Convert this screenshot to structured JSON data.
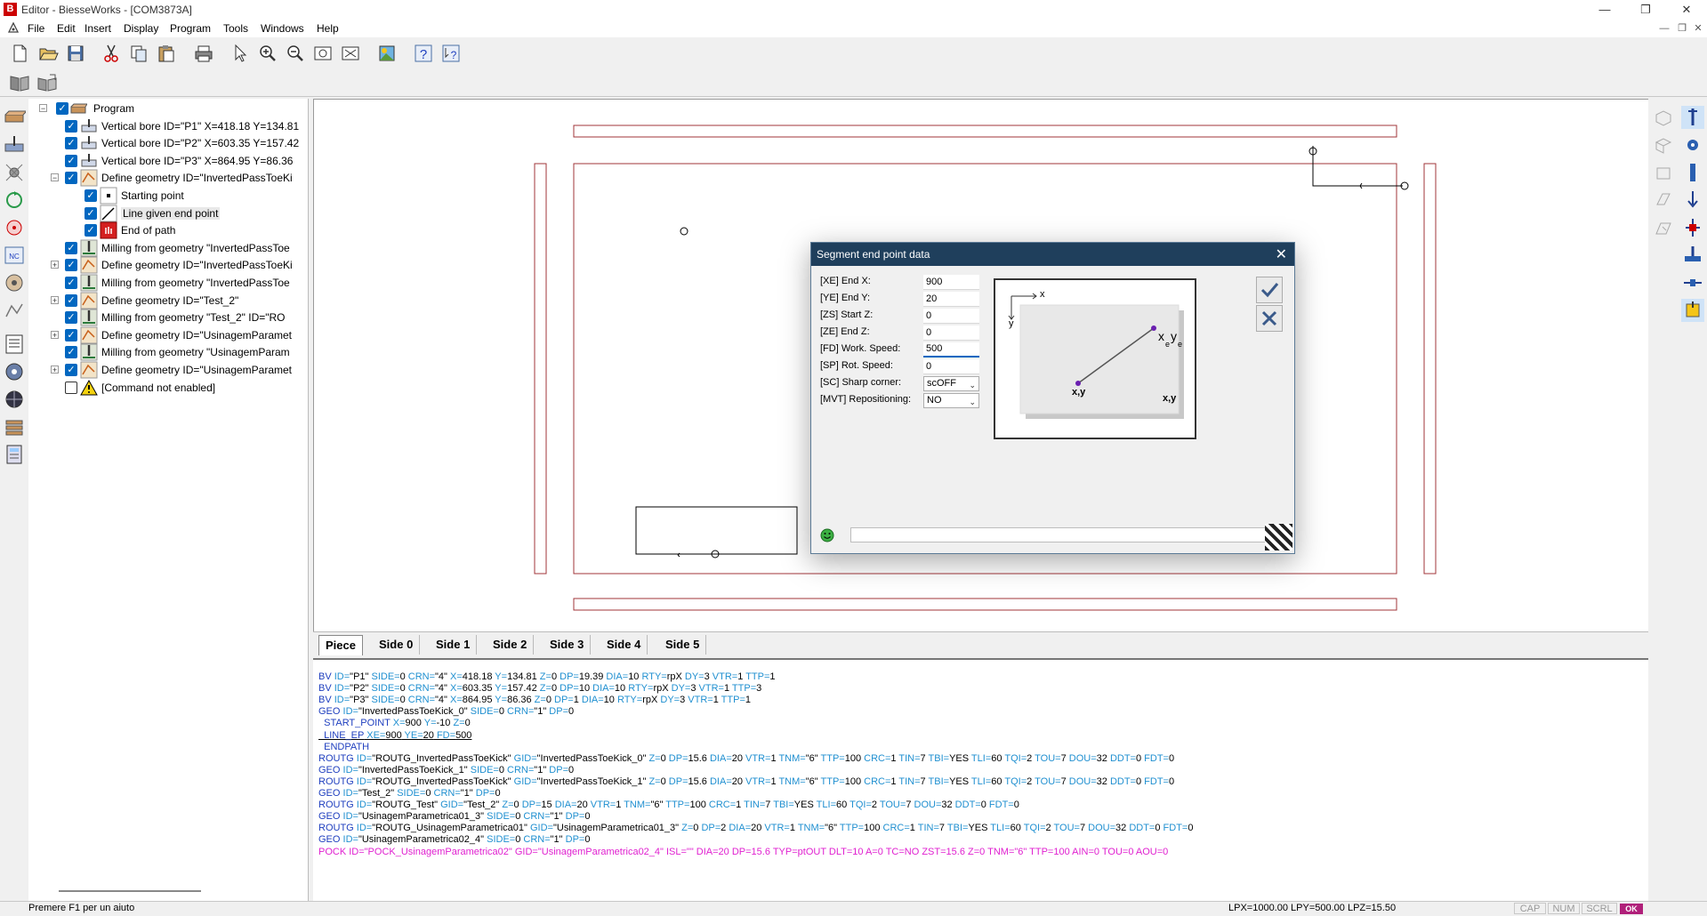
{
  "window": {
    "title": "Editor - BiesseWorks - [COM3873A]",
    "app_icon_letter": "B"
  },
  "menu": [
    "File",
    "Edit",
    "Insert",
    "Display",
    "Program",
    "Tools",
    "Windows",
    "Help"
  ],
  "tree": {
    "root": "Program",
    "items": [
      {
        "label": "Vertical bore ID=\"P1\" X=418.18 Y=134.81",
        "icon": "vertical-bore-icon"
      },
      {
        "label": "Vertical bore ID=\"P2\" X=603.35 Y=157.42",
        "icon": "vertical-bore-icon"
      },
      {
        "label": "Vertical bore ID=\"P3\" X=864.95 Y=86.36",
        "icon": "vertical-bore-icon"
      },
      {
        "label": "Define geometry ID=\"InvertedPassToeKi",
        "icon": "geometry-icon"
      },
      {
        "label": "Starting point",
        "icon": "starting-point-icon"
      },
      {
        "label": "Line given end point",
        "icon": "line-end-point-icon"
      },
      {
        "label": "End of path",
        "icon": "end-path-icon"
      },
      {
        "label": "Milling from geometry \"InvertedPassToe",
        "icon": "milling-icon"
      },
      {
        "label": "Define geometry ID=\"InvertedPassToeKi",
        "icon": "geometry-icon"
      },
      {
        "label": "Milling from geometry \"InvertedPassToe",
        "icon": "milling-icon"
      },
      {
        "label": "Define geometry ID=\"Test_2\"",
        "icon": "geometry-icon"
      },
      {
        "label": "Milling from geometry \"Test_2\" ID=\"RO",
        "icon": "milling-icon"
      },
      {
        "label": "Define geometry ID=\"UsinagemParamet",
        "icon": "geometry-icon"
      },
      {
        "label": "Milling from geometry \"UsinagemParam",
        "icon": "milling-icon"
      },
      {
        "label": "Define geometry ID=\"UsinagemParamet",
        "icon": "geometry-icon"
      },
      {
        "label": "[Command not enabled]",
        "icon": "warning-icon"
      }
    ]
  },
  "tabs": [
    "Piece",
    "Side 0",
    "Side 1",
    "Side 2",
    "Side 3",
    "Side 4",
    "Side 5"
  ],
  "active_tab": "Piece",
  "dialog": {
    "title": "Segment end point data",
    "fields": [
      {
        "label": "[XE] End X:",
        "value": "900"
      },
      {
        "label": "[YE] End Y:",
        "value": "20"
      },
      {
        "label": "[ZS] Start Z:",
        "value": "0"
      },
      {
        "label": "[ZE] End Z:",
        "value": "0"
      },
      {
        "label": "[FD] Work. Speed:",
        "value": "500"
      },
      {
        "label": "[SP] Rot. Speed:",
        "value": "0"
      }
    ],
    "selects": [
      {
        "label": "[SC] Sharp corner:",
        "value": "scOFF"
      },
      {
        "label": "[MVT] Repositioning:",
        "value": "NO"
      }
    ],
    "preview": {
      "axis_x": "x",
      "axis_y": "y",
      "end_label_x": "x",
      "end_label_y": "y",
      "end_sub": "e",
      "start_label": "x,y",
      "corner_label": "x,y"
    }
  },
  "code": [
    [
      [
        "BV",
        "kw"
      ],
      [
        " ID=",
        "at"
      ],
      [
        "\"P1\"",
        "v"
      ],
      [
        " SIDE=",
        "at"
      ],
      [
        "0",
        "v"
      ],
      [
        " CRN=",
        "at"
      ],
      [
        "\"4\"",
        "v"
      ],
      [
        " X=",
        "at"
      ],
      [
        "418.18",
        "v"
      ],
      [
        " Y=",
        "at"
      ],
      [
        "134.81",
        "v"
      ],
      [
        " Z=",
        "at"
      ],
      [
        "0",
        "v"
      ],
      [
        " DP=",
        "at"
      ],
      [
        "19.39",
        "v"
      ],
      [
        " DIA=",
        "at"
      ],
      [
        "10",
        "v"
      ],
      [
        " RTY=",
        "at"
      ],
      [
        "rpX",
        "v"
      ],
      [
        " DY=",
        "at"
      ],
      [
        "3",
        "v"
      ],
      [
        " VTR=",
        "at"
      ],
      [
        "1",
        "v"
      ],
      [
        " TTP=",
        "at"
      ],
      [
        "1",
        "v"
      ]
    ],
    [
      [
        "BV",
        "kw"
      ],
      [
        " ID=",
        "at"
      ],
      [
        "\"P2\"",
        "v"
      ],
      [
        " SIDE=",
        "at"
      ],
      [
        "0",
        "v"
      ],
      [
        " CRN=",
        "at"
      ],
      [
        "\"4\"",
        "v"
      ],
      [
        " X=",
        "at"
      ],
      [
        "603.35",
        "v"
      ],
      [
        " Y=",
        "at"
      ],
      [
        "157.42",
        "v"
      ],
      [
        " Z=",
        "at"
      ],
      [
        "0",
        "v"
      ],
      [
        " DP=",
        "at"
      ],
      [
        "10",
        "v"
      ],
      [
        " DIA=",
        "at"
      ],
      [
        "10",
        "v"
      ],
      [
        " RTY=",
        "at"
      ],
      [
        "rpX",
        "v"
      ],
      [
        " DY=",
        "at"
      ],
      [
        "3",
        "v"
      ],
      [
        " VTR=",
        "at"
      ],
      [
        "1",
        "v"
      ],
      [
        " TTP=",
        "at"
      ],
      [
        "3",
        "v"
      ]
    ],
    [
      [
        "BV",
        "kw"
      ],
      [
        " ID=",
        "at"
      ],
      [
        "\"P3\"",
        "v"
      ],
      [
        " SIDE=",
        "at"
      ],
      [
        "0",
        "v"
      ],
      [
        " CRN=",
        "at"
      ],
      [
        "\"4\"",
        "v"
      ],
      [
        " X=",
        "at"
      ],
      [
        "864.95",
        "v"
      ],
      [
        " Y=",
        "at"
      ],
      [
        "86.36",
        "v"
      ],
      [
        " Z=",
        "at"
      ],
      [
        "0",
        "v"
      ],
      [
        " DP=",
        "at"
      ],
      [
        "1",
        "v"
      ],
      [
        " DIA=",
        "at"
      ],
      [
        "10",
        "v"
      ],
      [
        " RTY=",
        "at"
      ],
      [
        "rpX",
        "v"
      ],
      [
        " DY=",
        "at"
      ],
      [
        "3",
        "v"
      ],
      [
        " VTR=",
        "at"
      ],
      [
        "1",
        "v"
      ],
      [
        " TTP=",
        "at"
      ],
      [
        "1",
        "v"
      ]
    ],
    [
      [
        "GEO",
        "kw"
      ],
      [
        " ID=",
        "at"
      ],
      [
        "\"InvertedPassToeKick_0\"",
        "v"
      ],
      [
        " SIDE=",
        "at"
      ],
      [
        "0",
        "v"
      ],
      [
        " CRN=",
        "at"
      ],
      [
        "\"1\"",
        "v"
      ],
      [
        " DP=",
        "at"
      ],
      [
        "0",
        "v"
      ]
    ],
    [
      [
        "  START_POINT",
        "kw"
      ],
      [
        " X=",
        "at"
      ],
      [
        "900",
        "v"
      ],
      [
        " Y=",
        "at"
      ],
      [
        "-10",
        "v"
      ],
      [
        " Z=",
        "at"
      ],
      [
        "0",
        "v"
      ]
    ],
    [
      [
        "  LINE_EP",
        "kw"
      ],
      [
        " XE=",
        "at"
      ],
      [
        "900",
        "v"
      ],
      [
        " YE=",
        "at"
      ],
      [
        "20",
        "v"
      ],
      [
        " FD=",
        "at"
      ],
      [
        "500",
        "v"
      ]
    ],
    [
      [
        "  ENDPATH",
        "kw"
      ]
    ],
    [
      [
        "ROUTG",
        "kw"
      ],
      [
        " ID=",
        "at"
      ],
      [
        "\"ROUTG_InvertedPassToeKick\"",
        "v"
      ],
      [
        " GID=",
        "at"
      ],
      [
        "\"InvertedPassToeKick_0\"",
        "v"
      ],
      [
        " Z=",
        "at"
      ],
      [
        "0",
        "v"
      ],
      [
        " DP=",
        "at"
      ],
      [
        "15.6",
        "v"
      ],
      [
        " DIA=",
        "at"
      ],
      [
        "20",
        "v"
      ],
      [
        " VTR=",
        "at"
      ],
      [
        "1",
        "v"
      ],
      [
        " TNM=",
        "at"
      ],
      [
        "\"6\"",
        "v"
      ],
      [
        " TTP=",
        "at"
      ],
      [
        "100",
        "v"
      ],
      [
        " CRC=",
        "at"
      ],
      [
        "1",
        "v"
      ],
      [
        " TIN=",
        "at"
      ],
      [
        "7",
        "v"
      ],
      [
        " TBI=",
        "at"
      ],
      [
        "YES",
        "v"
      ],
      [
        " TLI=",
        "at"
      ],
      [
        "60",
        "v"
      ],
      [
        " TQI=",
        "at"
      ],
      [
        "2",
        "v"
      ],
      [
        " TOU=",
        "at"
      ],
      [
        "7",
        "v"
      ],
      [
        " DOU=",
        "at"
      ],
      [
        "32",
        "v"
      ],
      [
        " DDT=",
        "at"
      ],
      [
        "0",
        "v"
      ],
      [
        " FDT=",
        "at"
      ],
      [
        "0",
        "v"
      ]
    ],
    [
      [
        "GEO",
        "kw"
      ],
      [
        " ID=",
        "at"
      ],
      [
        "\"InvertedPassToeKick_1\"",
        "v"
      ],
      [
        " SIDE=",
        "at"
      ],
      [
        "0",
        "v"
      ],
      [
        " CRN=",
        "at"
      ],
      [
        "\"1\"",
        "v"
      ],
      [
        " DP=",
        "at"
      ],
      [
        "0",
        "v"
      ]
    ],
    [
      [
        "ROUTG",
        "kw"
      ],
      [
        " ID=",
        "at"
      ],
      [
        "\"ROUTG_InvertedPassToeKick\"",
        "v"
      ],
      [
        " GID=",
        "at"
      ],
      [
        "\"InvertedPassToeKick_1\"",
        "v"
      ],
      [
        " Z=",
        "at"
      ],
      [
        "0",
        "v"
      ],
      [
        " DP=",
        "at"
      ],
      [
        "15.6",
        "v"
      ],
      [
        " DIA=",
        "at"
      ],
      [
        "20",
        "v"
      ],
      [
        " VTR=",
        "at"
      ],
      [
        "1",
        "v"
      ],
      [
        " TNM=",
        "at"
      ],
      [
        "\"6\"",
        "v"
      ],
      [
        " TTP=",
        "at"
      ],
      [
        "100",
        "v"
      ],
      [
        " CRC=",
        "at"
      ],
      [
        "1",
        "v"
      ],
      [
        " TIN=",
        "at"
      ],
      [
        "7",
        "v"
      ],
      [
        " TBI=",
        "at"
      ],
      [
        "YES",
        "v"
      ],
      [
        " TLI=",
        "at"
      ],
      [
        "60",
        "v"
      ],
      [
        " TQI=",
        "at"
      ],
      [
        "2",
        "v"
      ],
      [
        " TOU=",
        "at"
      ],
      [
        "7",
        "v"
      ],
      [
        " DOU=",
        "at"
      ],
      [
        "32",
        "v"
      ],
      [
        " DDT=",
        "at"
      ],
      [
        "0",
        "v"
      ],
      [
        " FDT=",
        "at"
      ],
      [
        "0",
        "v"
      ]
    ],
    [
      [
        "GEO",
        "kw"
      ],
      [
        " ID=",
        "at"
      ],
      [
        "\"Test_2\"",
        "v"
      ],
      [
        " SIDE=",
        "at"
      ],
      [
        "0",
        "v"
      ],
      [
        " CRN=",
        "at"
      ],
      [
        "\"1\"",
        "v"
      ],
      [
        " DP=",
        "at"
      ],
      [
        "0",
        "v"
      ]
    ],
    [
      [
        "ROUTG",
        "kw"
      ],
      [
        " ID=",
        "at"
      ],
      [
        "\"ROUTG_Test\"",
        "v"
      ],
      [
        " GID=",
        "at"
      ],
      [
        "\"Test_2\"",
        "v"
      ],
      [
        " Z=",
        "at"
      ],
      [
        "0",
        "v"
      ],
      [
        " DP=",
        "at"
      ],
      [
        "15",
        "v"
      ],
      [
        " DIA=",
        "at"
      ],
      [
        "20",
        "v"
      ],
      [
        " VTR=",
        "at"
      ],
      [
        "1",
        "v"
      ],
      [
        " TNM=",
        "at"
      ],
      [
        "\"6\"",
        "v"
      ],
      [
        " TTP=",
        "at"
      ],
      [
        "100",
        "v"
      ],
      [
        " CRC=",
        "at"
      ],
      [
        "1",
        "v"
      ],
      [
        " TIN=",
        "at"
      ],
      [
        "7",
        "v"
      ],
      [
        " TBI=",
        "at"
      ],
      [
        "YES",
        "v"
      ],
      [
        " TLI=",
        "at"
      ],
      [
        "60",
        "v"
      ],
      [
        " TQI=",
        "at"
      ],
      [
        "2",
        "v"
      ],
      [
        " TOU=",
        "at"
      ],
      [
        "7",
        "v"
      ],
      [
        " DOU=",
        "at"
      ],
      [
        "32",
        "v"
      ],
      [
        " DDT=",
        "at"
      ],
      [
        "0",
        "v"
      ],
      [
        " FDT=",
        "at"
      ],
      [
        "0",
        "v"
      ]
    ],
    [
      [
        "GEO",
        "kw"
      ],
      [
        " ID=",
        "at"
      ],
      [
        "\"UsinagemParametrica01_3\"",
        "v"
      ],
      [
        " SIDE=",
        "at"
      ],
      [
        "0",
        "v"
      ],
      [
        " CRN=",
        "at"
      ],
      [
        "\"1\"",
        "v"
      ],
      [
        " DP=",
        "at"
      ],
      [
        "0",
        "v"
      ]
    ],
    [
      [
        "ROUTG",
        "kw"
      ],
      [
        " ID=",
        "at"
      ],
      [
        "\"ROUTG_UsinagemParametrica01\"",
        "v"
      ],
      [
        " GID=",
        "at"
      ],
      [
        "\"UsinagemParametrica01_3\"",
        "v"
      ],
      [
        " Z=",
        "at"
      ],
      [
        "0",
        "v"
      ],
      [
        " DP=",
        "at"
      ],
      [
        "2",
        "v"
      ],
      [
        " DIA=",
        "at"
      ],
      [
        "20",
        "v"
      ],
      [
        " VTR=",
        "at"
      ],
      [
        "1",
        "v"
      ],
      [
        " TNM=",
        "at"
      ],
      [
        "\"6\"",
        "v"
      ],
      [
        " TTP=",
        "at"
      ],
      [
        "100",
        "v"
      ],
      [
        " CRC=",
        "at"
      ],
      [
        "1",
        "v"
      ],
      [
        " TIN=",
        "at"
      ],
      [
        "7",
        "v"
      ],
      [
        " TBI=",
        "at"
      ],
      [
        "YES",
        "v"
      ],
      [
        " TLI=",
        "at"
      ],
      [
        "60",
        "v"
      ],
      [
        " TQI=",
        "at"
      ],
      [
        "2",
        "v"
      ],
      [
        " TOU=",
        "at"
      ],
      [
        "7",
        "v"
      ],
      [
        " DOU=",
        "at"
      ],
      [
        "32",
        "v"
      ],
      [
        " DDT=",
        "at"
      ],
      [
        "0",
        "v"
      ],
      [
        " FDT=",
        "at"
      ],
      [
        "0",
        "v"
      ]
    ],
    [
      [
        "GEO",
        "kw"
      ],
      [
        " ID=",
        "at"
      ],
      [
        "\"UsinagemParametrica02_4\"",
        "v"
      ],
      [
        " SIDE=",
        "at"
      ],
      [
        "0",
        "v"
      ],
      [
        " CRN=",
        "at"
      ],
      [
        "\"1\"",
        "v"
      ],
      [
        " DP=",
        "at"
      ],
      [
        "0",
        "v"
      ]
    ],
    [
      [
        "POCK ID=\"POCK_UsinagemParametrica02\" GID=\"UsinagemParametrica02_4\" ISL=\"\" DIA=20 DP=15.6 TYP=ptOUT DLT=10 A=0 TC=NO ZST=15.6 Z=0 TNM=\"6\" TTP=100 AIN=0 TOU=0 AOU=0",
        "pk"
      ]
    ]
  ],
  "code_colors": {
    "kw": "#1f3fbf",
    "at": "#1f8fd0",
    "v": "#000000",
    "pk": "#e020d0"
  },
  "status": {
    "hint": "Premere F1 per un aiuto",
    "dims": "LPX=1000.00  LPY=500.00  LPZ=15.50",
    "indicators": [
      "CAP",
      "NUM",
      "SCRL"
    ],
    "ok": "OK"
  },
  "colors": {
    "accent": "#0067c0",
    "dialog_title": "#1f3f5c",
    "piece_outline": "#a0353a"
  }
}
